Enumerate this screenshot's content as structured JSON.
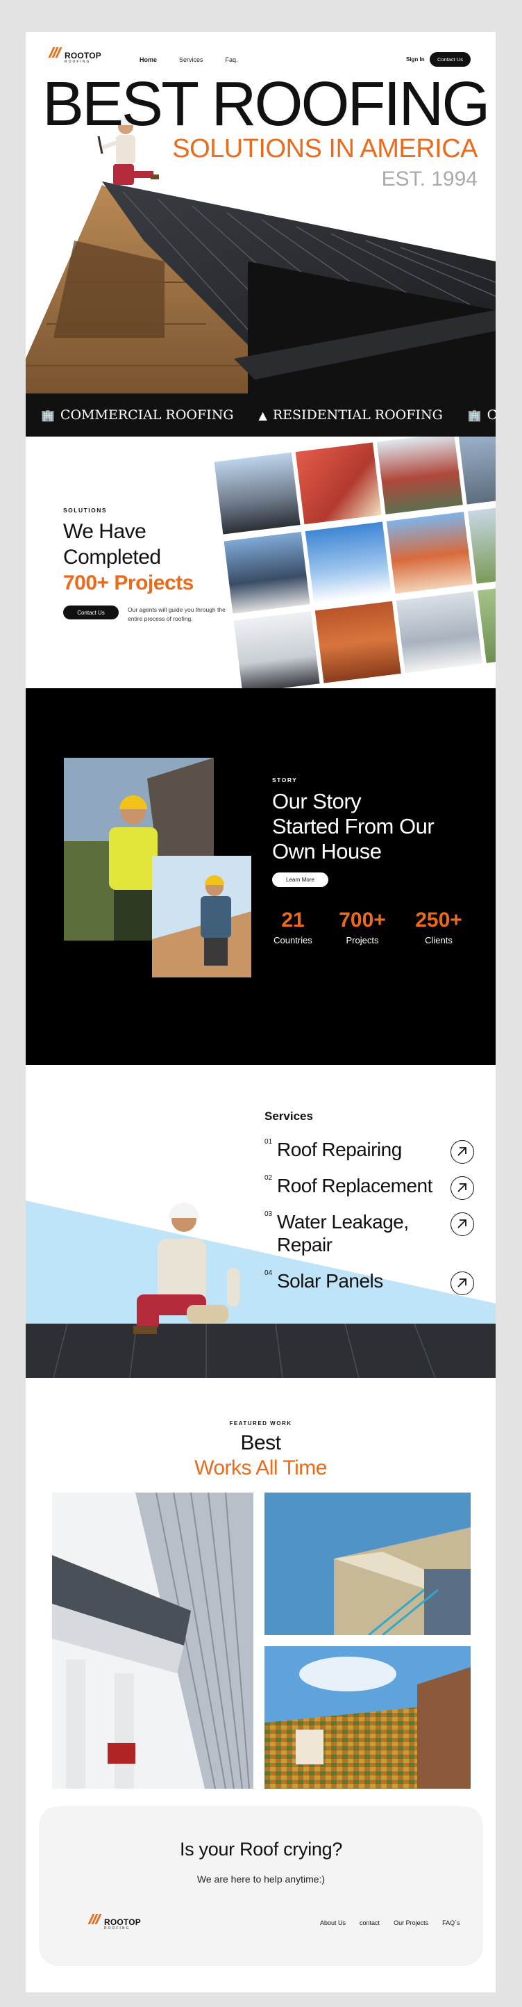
{
  "nav": {
    "logo_name": "ROOTOP",
    "logo_sub": "ROOFING",
    "links": [
      "Home",
      "Services",
      "Faq."
    ],
    "sign_in": "Sign In",
    "contact": "Contact Us"
  },
  "hero": {
    "title": "BEST ROOFING",
    "subtitle": "SOLUTIONS IN AMERICA",
    "est": "EST. 1994"
  },
  "marquee": [
    {
      "icon": "commercial-building-icon",
      "label": "COMMERCIAL ROOFING"
    },
    {
      "icon": "house-roof-icon",
      "label": "RESIDENTIAL ROOFING"
    },
    {
      "icon": "commercial-building-icon",
      "label": "COMMERCIAL ROOFING"
    }
  ],
  "projects": {
    "eyebrow": "SOLUTIONS",
    "heading_line1": "We Have",
    "heading_line2": "Completed",
    "heading_highlight": "700+ Projects",
    "button": "Contact Us",
    "description": "Our agents will guide you through the entire process of roofing."
  },
  "story": {
    "eyebrow": "STORY",
    "heading_line1": "Our Story",
    "heading_line2": "Started From Our",
    "heading_line3": "Own House",
    "button": "Learn More",
    "stats": [
      {
        "value": "21",
        "label": "Countries"
      },
      {
        "value": "700+",
        "label": "Projects"
      },
      {
        "value": "250+",
        "label": "Clients"
      }
    ]
  },
  "services": {
    "heading": "Services",
    "items": [
      {
        "num": "01",
        "title": "Roof Repairing"
      },
      {
        "num": "02",
        "title": "Roof Replacement"
      },
      {
        "num": "03",
        "title": "Water Leakage, Repair"
      },
      {
        "num": "04",
        "title": "Solar Panels"
      }
    ]
  },
  "featured": {
    "eyebrow": "FEATURED WORK",
    "heading_line1": "Best",
    "heading_line2": "Works All Time"
  },
  "cta": {
    "heading": "Is your Roof crying?",
    "subtext": "We are here to help anytime:)",
    "links": [
      "About Us",
      "contact",
      "Our Projects",
      "FAQ`s"
    ]
  },
  "colors": {
    "accent": "#ea6b1c",
    "dark": "#111111",
    "sky": "#bfe4f7"
  }
}
